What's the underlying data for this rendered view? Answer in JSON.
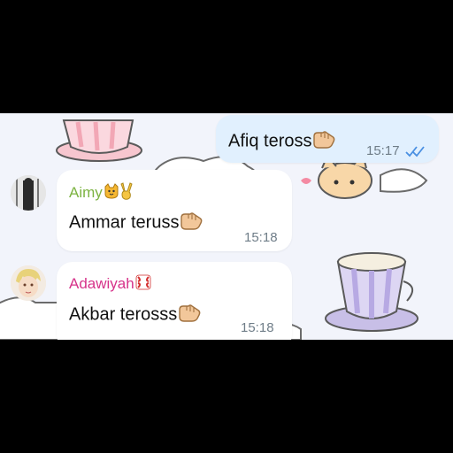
{
  "colors": {
    "outgoing_bubble": "#e1f0fe",
    "incoming_bubble": "#ffffff",
    "sender_aimy": "#7cb342",
    "sender_adawiyah": "#d6338a",
    "read_ticks": "#4a90e2"
  },
  "messages": [
    {
      "direction": "outgoing",
      "text": "Afiq teross",
      "emoji": "pointing-hand",
      "time": "15:17",
      "status_icon": "double-check-read"
    },
    {
      "direction": "incoming",
      "sender": "Aimy",
      "sender_emojis": [
        "cat-face",
        "victory-hand"
      ],
      "avatar": "dark-person-avatar",
      "text": "Ammar teruss",
      "emoji": "pointing-hand",
      "time": "15:18"
    },
    {
      "direction": "incoming",
      "sender": "Adawiyah",
      "sender_emojis": [
        "anger-symbol"
      ],
      "avatar": "anime-character-avatar",
      "text": "Akbar terosss",
      "emoji": "pointing-hand",
      "time": "15:18"
    }
  ]
}
